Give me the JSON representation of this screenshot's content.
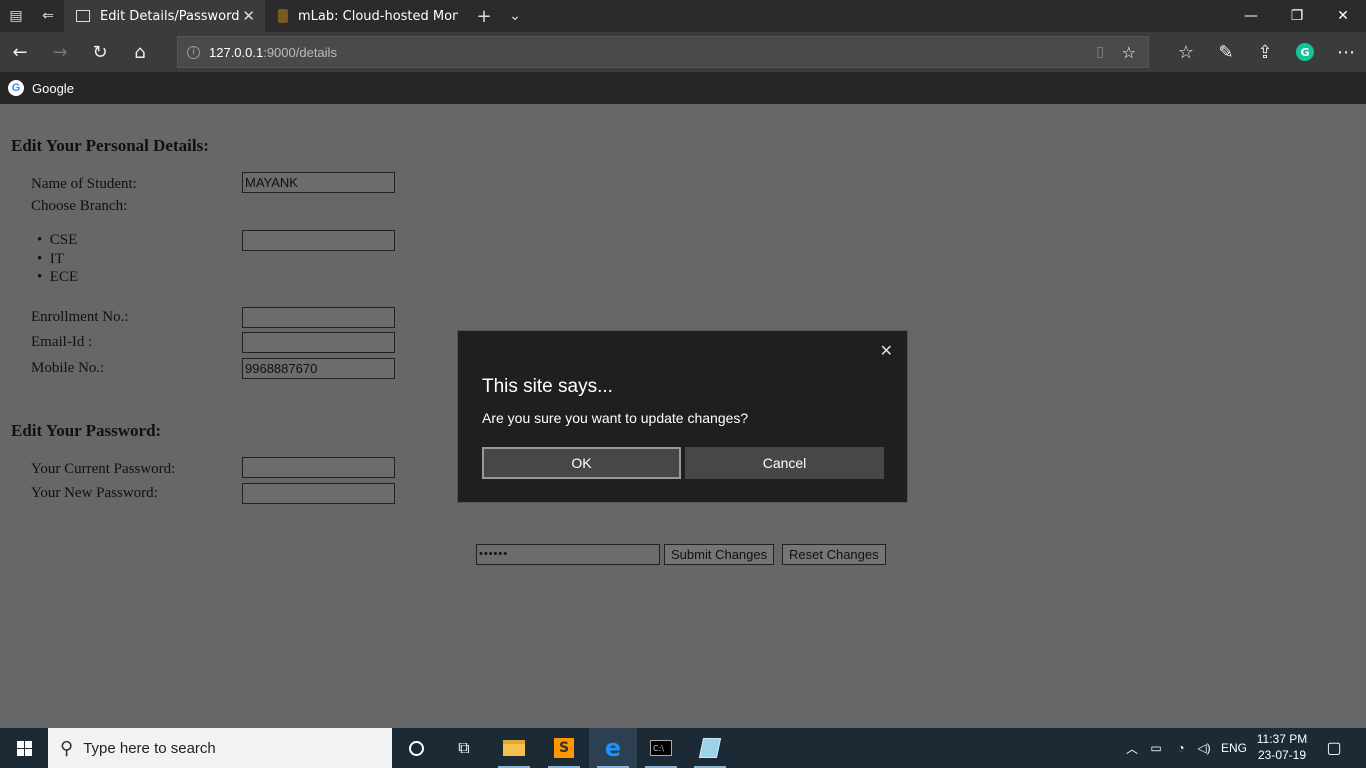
{
  "browser": {
    "tabs": [
      {
        "title": "Edit Details/Password",
        "active": true
      },
      {
        "title": "mLab: Cloud-hosted Mongo",
        "active": false
      }
    ],
    "address": {
      "host": "127.0.0.1",
      "path": ":9000/details"
    },
    "favorites": [
      {
        "label": "Google"
      }
    ]
  },
  "page": {
    "personal_heading": "Edit Your Personal Details:",
    "name_label": "Name of Student:",
    "name_value": "MAYANK",
    "branch_label": "Choose Branch:",
    "branches": [
      "CSE",
      "IT",
      "ECE"
    ],
    "enrollment_label": "Enrollment No.:",
    "enrollment_value": "",
    "email_label": "Email-Id :",
    "email_value": "",
    "mobile_label": "Mobile No.:",
    "mobile_value": "9968887670",
    "password_heading": "Edit Your Password:",
    "current_password_label": "Your Current Password:",
    "new_password_label": "Your New Password:",
    "verify_password_value": "••••••",
    "submit_label": "Submit Changes",
    "reset_label": "Reset Changes"
  },
  "dialog": {
    "title": "This site says...",
    "message": "Are you sure you want to update changes?",
    "ok_label": "OK",
    "cancel_label": "Cancel"
  },
  "taskbar": {
    "search_placeholder": "Type here to search",
    "language": "ENG",
    "time": "11:37 PM",
    "date": "23-07-19"
  },
  "colors": {
    "page_overlay": "#676767",
    "dialog_bg": "#1f1f1f",
    "taskbar_bg": "#1c2a36"
  }
}
